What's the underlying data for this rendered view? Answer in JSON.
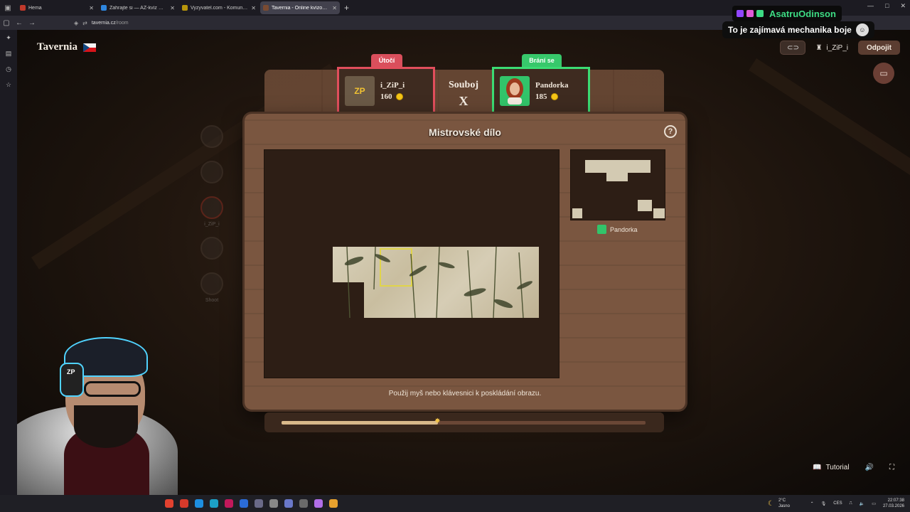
{
  "browser": {
    "tabs": [
      {
        "title": "Hema",
        "active": false,
        "favicon_color": "#c0392b"
      },
      {
        "title": "Zahrajte si — AZ-kvíz — Česká",
        "active": false,
        "favicon_color": "#2e86de"
      },
      {
        "title": "Vyzyvatel.com - Komunitní věd",
        "active": false,
        "favicon_color": "#b7950b"
      },
      {
        "title": "Tavernia - Online kvízová h",
        "active": true,
        "favicon_color": "#7a4b32"
      }
    ],
    "url_domain": "tavernia.cz",
    "url_path": "/room"
  },
  "app": {
    "brand": "Tavernia",
    "user": "i_ZiP_i",
    "disconnect_label": "Odpojit"
  },
  "duel": {
    "attacker_role": "Útočí",
    "defender_role": "Brání se",
    "versus_label": "Souboj",
    "versus_mark": "X",
    "attacker": {
      "name": "i_ZiP_i",
      "score": "160",
      "avatar_text": "ZP"
    },
    "defender": {
      "name": "Pandorka",
      "score": "185",
      "avatar_text": ""
    }
  },
  "board": {
    "title": "Mistrovské dílo",
    "help": "?",
    "preview_player": "Pandorka",
    "instruction": "Použij myš nebo klávesnici k poskládání obrazu.",
    "progress": 0.43
  },
  "steps": [
    {
      "label": "",
      "active": false
    },
    {
      "label": "",
      "active": false
    },
    {
      "label": "i_ZiP_i",
      "active": true
    },
    {
      "label": "",
      "active": false
    },
    {
      "label": "Shoot",
      "active": false
    }
  ],
  "bottom_tools": {
    "tutorial_label": "Tutorial"
  },
  "overlay": {
    "twitch_user": "AsatruOdinson",
    "chat_message": "To je zajímavá mechanika boje"
  },
  "taskbar": {
    "weather_temp": "2°C",
    "weather_desc": "Jasno",
    "lang": "CES",
    "time": "22:07:38",
    "date": "27.03.2026"
  }
}
